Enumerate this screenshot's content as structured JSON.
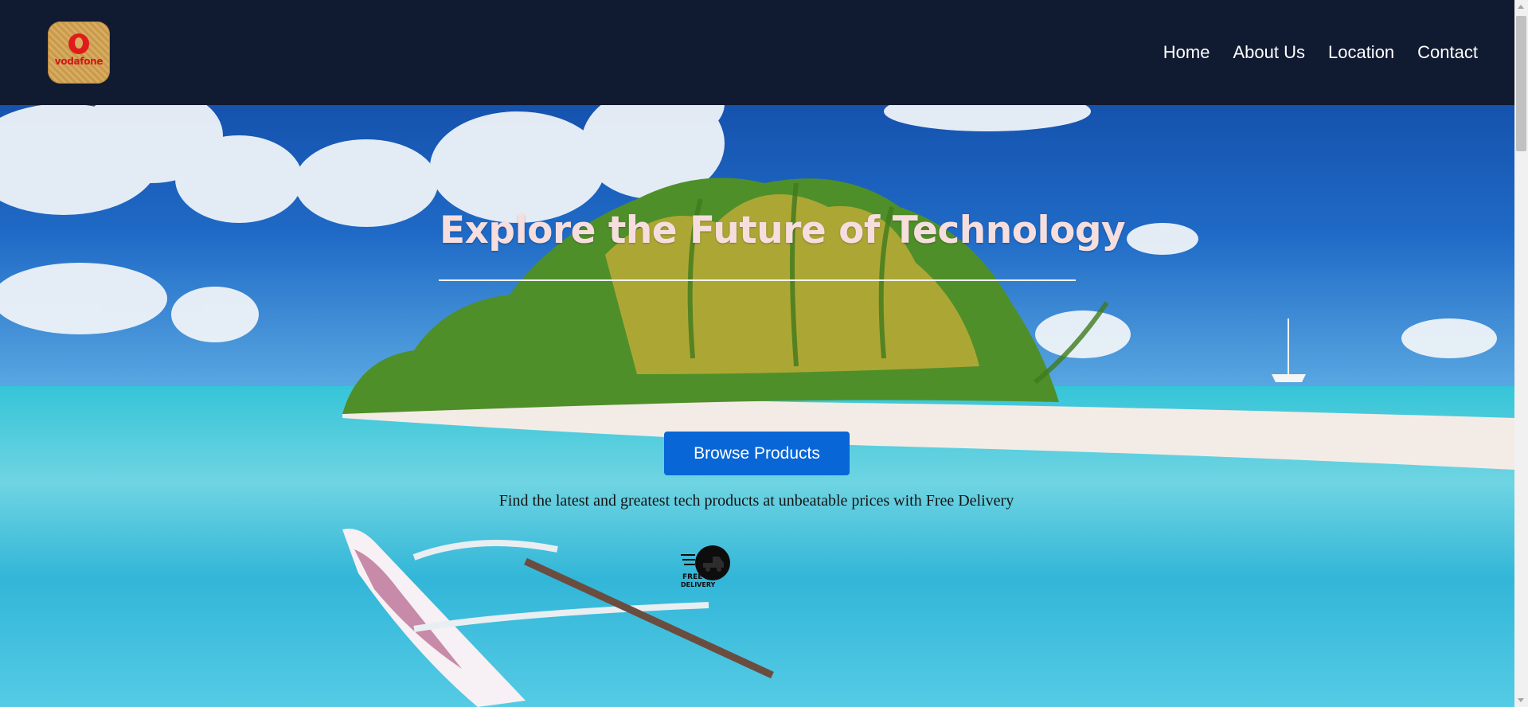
{
  "brand": {
    "name": "vodafone",
    "logo_color": "#e01b1b"
  },
  "nav": {
    "items": [
      {
        "label": "Home"
      },
      {
        "label": "About Us"
      },
      {
        "label": "Location"
      },
      {
        "label": "Contact"
      }
    ]
  },
  "hero": {
    "title": "Explore the Future of Technology",
    "cta_label": "Browse Products",
    "tagline": "Find the latest and greatest tech products at unbeatable prices with Free Delivery",
    "delivery_badge": {
      "icon": "free-delivery-truck-icon",
      "text_line1": "FREE",
      "text_line2": "DELIVERY"
    }
  },
  "colors": {
    "navbar_bg": "#101a30",
    "cta_bg": "#0866d6",
    "title_color": "#f6dede"
  }
}
